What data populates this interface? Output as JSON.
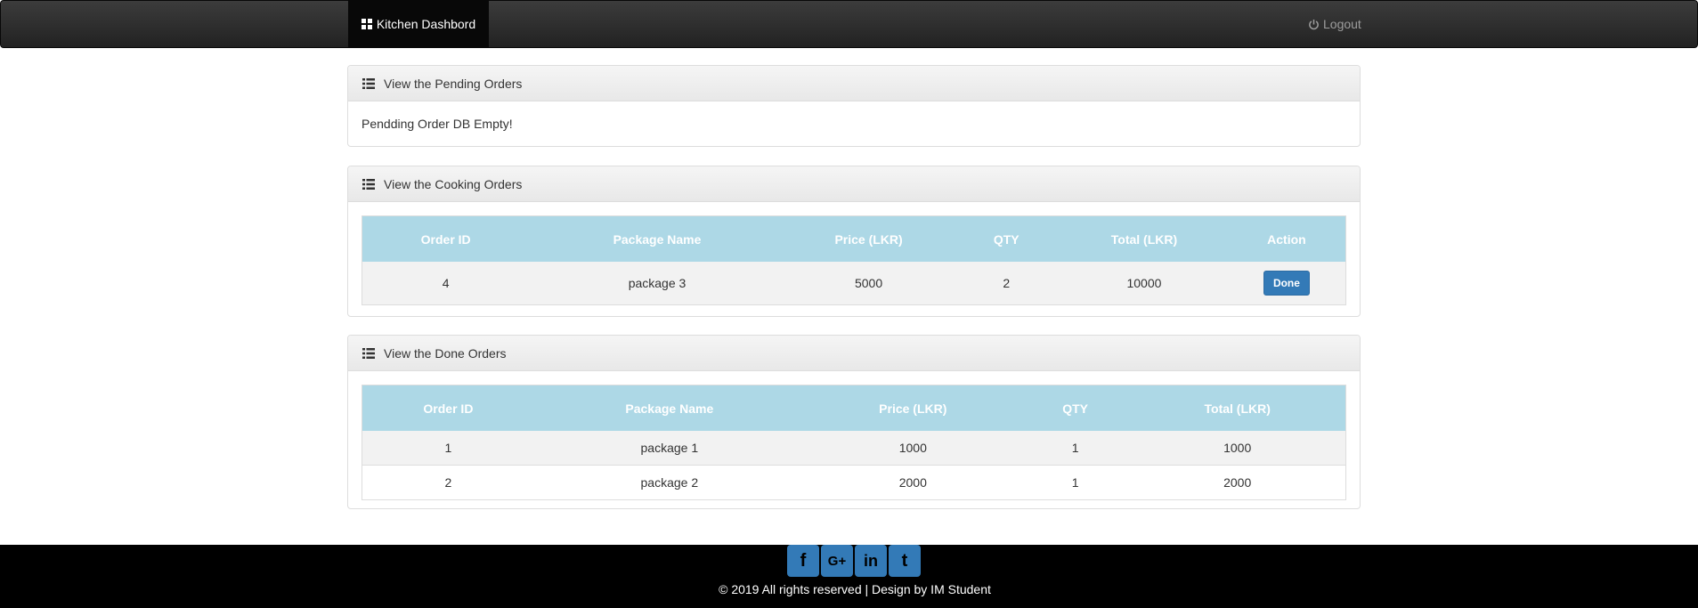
{
  "navbar": {
    "brand": "Kitchen Dashbord",
    "logout": "Logout"
  },
  "pending": {
    "title": "View the Pending Orders",
    "message": "Pendding Order DB Empty!"
  },
  "cooking": {
    "title": "View the Cooking Orders",
    "columns": [
      "Order ID",
      "Package Name",
      "Price (LKR)",
      "QTY",
      "Total (LKR)",
      "Action"
    ],
    "rows": [
      {
        "id": "4",
        "package": "package 3",
        "price": "5000",
        "qty": "2",
        "total": "10000",
        "action": "Done"
      }
    ]
  },
  "done": {
    "title": "View the Done Orders",
    "columns": [
      "Order ID",
      "Package Name",
      "Price (LKR)",
      "QTY",
      "Total (LKR)"
    ],
    "rows": [
      {
        "id": "1",
        "package": "package 1",
        "price": "1000",
        "qty": "1",
        "total": "1000"
      },
      {
        "id": "2",
        "package": "package 2",
        "price": "2000",
        "qty": "1",
        "total": "2000"
      }
    ]
  },
  "footer": {
    "social": [
      {
        "name": "facebook-icon",
        "glyph": "f"
      },
      {
        "name": "google-plus-icon",
        "glyph": "G+"
      },
      {
        "name": "linkedin-icon",
        "glyph": "in"
      },
      {
        "name": "twitter-icon",
        "glyph": "t"
      }
    ],
    "copyright": "© 2019 All rights reserved | Design by IM Student"
  },
  "colors": {
    "navbar": "#222222",
    "table_header": "#add8e6",
    "primary_button": "#337ab7",
    "footer": "#000000"
  }
}
